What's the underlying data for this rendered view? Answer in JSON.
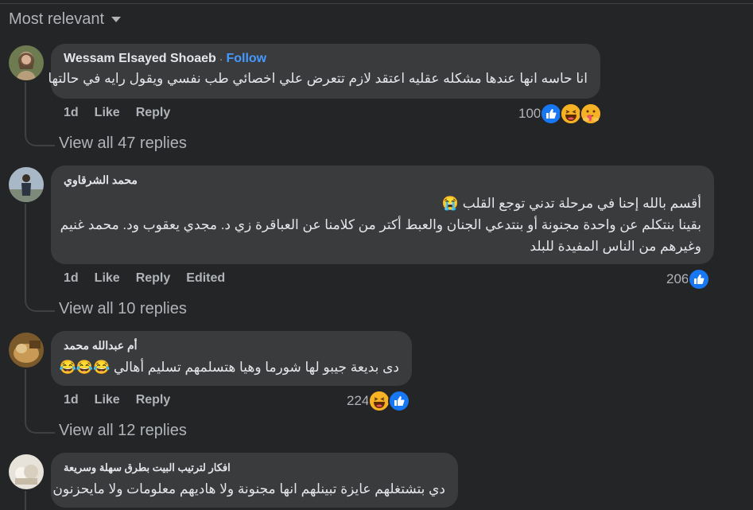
{
  "sort": {
    "label": "Most relevant",
    "icon": "caret-down-icon"
  },
  "comments": [
    {
      "author": "Wessam Elsayed Shoaeb",
      "follow": "Follow",
      "separator": "·",
      "lines": [
        "انا حاسه انها عندها مشكله عقليه اعتقد لازم تتعرض علي اخصائي طب نفسي ويقول رايه في حالتها"
      ],
      "time": "1d",
      "like": "Like",
      "reply": "Reply",
      "reaction_count": "100",
      "reactions": [
        "like-icon",
        "haha-icon",
        "care-icon"
      ],
      "view_replies": "View all 47 replies"
    },
    {
      "author": "محمد الشرقاوي",
      "lines": [
        "أقسم بالله إحنا في مرحلة تدني توجع القلب 😭",
        "بقينا بنتكلم عن واحدة مجنونة أو بنتدعي الجنان والعبط أكتر من كلامنا عن العباقرة زي د. مجدي يعقوب ود. محمد غنيم",
        "وغيرهم من الناس المفيدة للبلد"
      ],
      "time": "1d",
      "like": "Like",
      "reply": "Reply",
      "edited": "Edited",
      "reaction_count": "206",
      "reactions": [
        "like-icon"
      ],
      "view_replies": "View all 10 replies"
    },
    {
      "author": "أم عبدالله محمد",
      "lines": [
        "دى بديعة جيبو لها شورما وهيا هتسلمهم تسليم أهالي 😂😂😂"
      ],
      "time": "1d",
      "like": "Like",
      "reply": "Reply",
      "reaction_count": "224",
      "reactions": [
        "haha-icon",
        "like-icon"
      ],
      "view_replies": "View all 12 replies"
    },
    {
      "author": "افكار لترتيب البيت بطرق سهلة وسريعة",
      "lines": [
        "دي بتشتغلهم عايزة تبينلهم انها مجنونة ولا هاديهم معلومات ولا مايحزنون"
      ]
    }
  ],
  "colors": {
    "background": "#242526",
    "bubble": "#3a3b3c",
    "link": "#4599ff",
    "like": "#1877f2",
    "muted": "#b0b3b8"
  }
}
